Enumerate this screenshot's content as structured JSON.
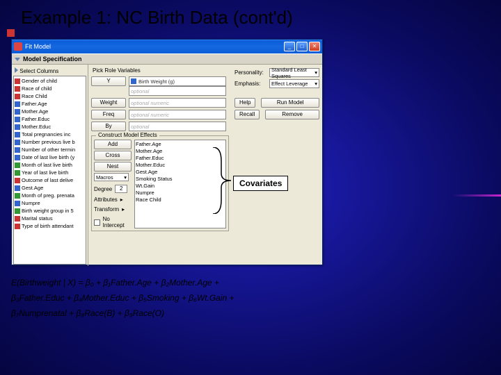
{
  "slide": {
    "title": "Example 1:  NC Birth Data (cont'd)",
    "callout": "Covariates"
  },
  "window": {
    "title": "Fit Model",
    "controls": {
      "min": "_",
      "max": "□",
      "close": "✕"
    },
    "section": "Model Specification",
    "select_columns_label": "Select Columns",
    "columns": [
      {
        "name": "Gender of child",
        "icon": "red"
      },
      {
        "name": "Race of child",
        "icon": "red"
      },
      {
        "name": "Race Child",
        "icon": "red"
      },
      {
        "name": "Father.Age",
        "icon": "blue"
      },
      {
        "name": "Mother.Age",
        "icon": "blue"
      },
      {
        "name": "Father.Educ",
        "icon": "blue"
      },
      {
        "name": "Mother.Educ",
        "icon": "blue"
      },
      {
        "name": "Total pregnancies inc",
        "icon": "blue"
      },
      {
        "name": "Number previous live b",
        "icon": "blue"
      },
      {
        "name": "Number of other termin",
        "icon": "blue"
      },
      {
        "name": "Date of last live birth (y",
        "icon": "blue"
      },
      {
        "name": "Month of last live birth",
        "icon": "green"
      },
      {
        "name": "Year of last live birth",
        "icon": "green"
      },
      {
        "name": "Outcome of last delive",
        "icon": "red"
      },
      {
        "name": "Gest.Age",
        "icon": "blue"
      },
      {
        "name": "Month of preg. prenata",
        "icon": "green"
      },
      {
        "name": "Numpre",
        "icon": "blue"
      },
      {
        "name": "Birth weight group in 5",
        "icon": "green"
      },
      {
        "name": "Marital status",
        "icon": "red"
      },
      {
        "name": "Type of birth attendant",
        "icon": "red"
      }
    ],
    "pick_role_label": "Pick Role Variables",
    "roles": {
      "y_btn": "Y",
      "y_val": "Birth Weight (g)",
      "y_opt": "optional",
      "weight_btn": "Weight",
      "weight_opt": "optional numeric",
      "freq_btn": "Freq",
      "freq_opt": "optional numeric",
      "by_btn": "By",
      "by_opt": "optional"
    },
    "right": {
      "personality_label": "Personality:",
      "personality_val": "Standard Least Squares",
      "emphasis_label": "Emphasis:",
      "emphasis_val": "Effect Leverage",
      "help_btn": "Help",
      "run_btn": "Run Model",
      "recall_btn": "Recall",
      "remove_btn": "Remove"
    },
    "effects": {
      "header": "Construct Model Effects",
      "add_btn": "Add",
      "cross_btn": "Cross",
      "nest_btn": "Nest",
      "macros_label": "Macros",
      "degree_label": "Degree",
      "degree_val": "2",
      "attributes_label": "Attributes",
      "transform_label": "Transform",
      "nointercept_label": "No Intercept",
      "list": [
        "Father.Age",
        "Mother.Age",
        "Father.Educ",
        "Mother.Educ",
        "Gest.Age",
        "Smoking Status",
        "Wt.Gain",
        "Numpre",
        "Race Child"
      ]
    }
  },
  "equation": {
    "line1": "E(Birthweight | X) = β₀ + β₁Father.Age + β₂Mother.Age +",
    "line2": "β₃Father.Educ + β₄Mother.Educ + β₅Smoking + β₆Wt.Gain +",
    "line3": "β₇Numprenatal + β₈Race(B) + β₉Race(O)"
  },
  "chart_data": null
}
